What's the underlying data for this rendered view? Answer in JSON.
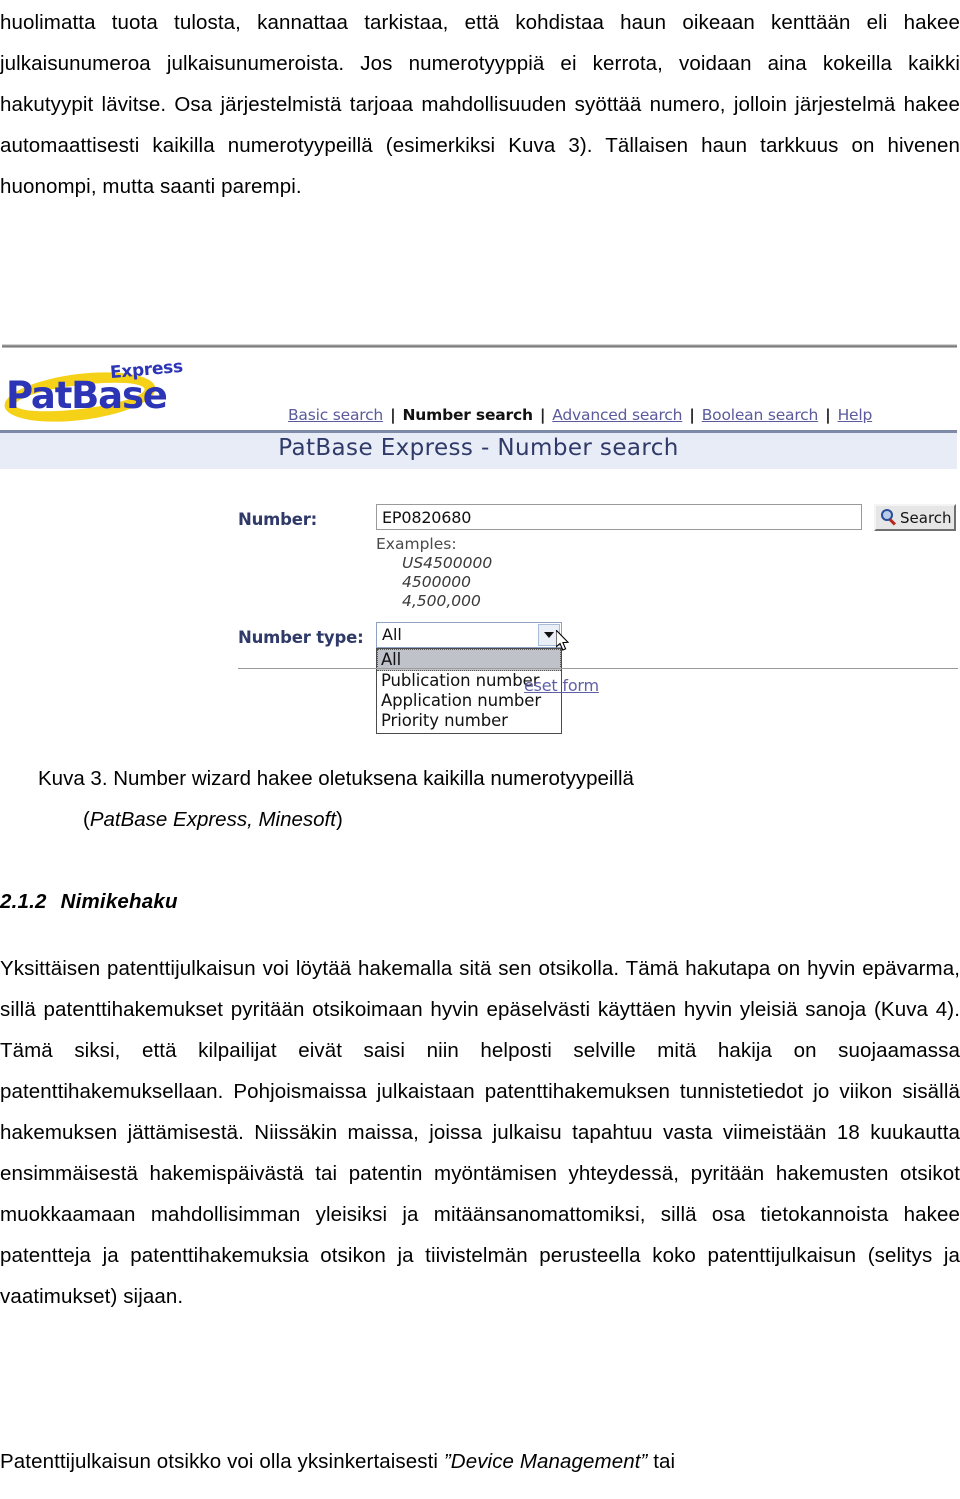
{
  "document": {
    "paragraph_top": "huolimatta tuota tulosta, kannattaa tarkistaa, että kohdistaa haun oikeaan kenttään eli hakee julkaisunumeroa julkaisunumeroista. Jos numerotyyppiä ei kerrota, voidaan aina kokeilla kaikki hakutyypit lävitse. Osa järjestelmistä tarjoaa mahdollisuuden syöttää numero, jolloin järjestelmä hakee automaattisesti kaikilla numerotyypeillä (esimerkiksi Kuva 3). Tällaisen haun tarkkuus on hivenen huonompi, mutta saanti parempi.",
    "figure_caption_line1": "Kuva 3. Number wizard hakee oletuksena kaikilla numerotyypeillä",
    "figure_caption_line2_open": "(",
    "figure_caption_line2_italic": "PatBase Express, Minesoft",
    "figure_caption_line2_close": ")",
    "section_number": "2.1.2",
    "section_title": "Nimikehaku",
    "paragraph_mid": "Yksittäisen patenttijulkaisun voi löytää hakemalla sitä sen otsikolla. Tämä hakutapa on hyvin epävarma, sillä patenttihakemukset pyritään otsikoimaan hyvin epäselvästi käyttäen hyvin yleisiä sanoja (Kuva 4). Tämä siksi, että kilpailijat eivät saisi niin helposti selville mitä hakija on suojaamassa patenttihakemuksellaan. Pohjoismaissa julkaistaan patenttihakemuksen tunnistetiedot jo viikon sisällä hakemuksen jättämisestä. Niissäkin maissa, joissa julkaisu tapahtuu vasta viimeistään 18 kuukautta ensimmäisestä hakemispäivästä tai patentin myöntämisen yhteydessä, pyritään hakemusten otsikot muokkaamaan mahdollisimman yleisiksi ja mitäänsanomattomiksi, sillä osa tietokannoista hakee patentteja ja patenttihakemuksia otsikon ja tiivistelmän perusteella koko patenttijulkaisun (selitys ja vaatimukset) sijaan.",
    "paragraph_tail_before": "Patenttijulkaisun otsikko voi olla yksinkertaisesti ",
    "paragraph_tail_italic": "”Device Management”",
    "paragraph_tail_after": " tai"
  },
  "figure": {
    "logo": {
      "brand": "PatBase",
      "edition": "Express",
      "brand_color": "#2b35b5",
      "ellipse_color": "#f5d117"
    },
    "nav": {
      "items": [
        {
          "label": "Basic search",
          "active": false
        },
        {
          "label": "Number search",
          "active": true
        },
        {
          "label": "Advanced search",
          "active": false
        },
        {
          "label": "Boolean search",
          "active": false
        },
        {
          "label": "Help",
          "active": false
        }
      ],
      "separator": "|"
    },
    "title_band": {
      "text": "PatBase Express - Number search",
      "background": "#e7ecf7",
      "text_color": "#2f3a68"
    },
    "form": {
      "number_label": "Number:",
      "number_value": "EP0820680",
      "number_placeholder": "",
      "search_button_label": "Search",
      "examples_heading": "Examples:",
      "examples": [
        "US4500000",
        "4500000",
        "4,500,000"
      ],
      "number_type_label": "Number type:",
      "number_type_value": "All",
      "number_type_options": [
        "All",
        "Publication number",
        "Application number",
        "Priority number"
      ],
      "number_type_selected_option": "All",
      "reset_link": "eset form",
      "reset_link_full": "Reset form"
    }
  }
}
